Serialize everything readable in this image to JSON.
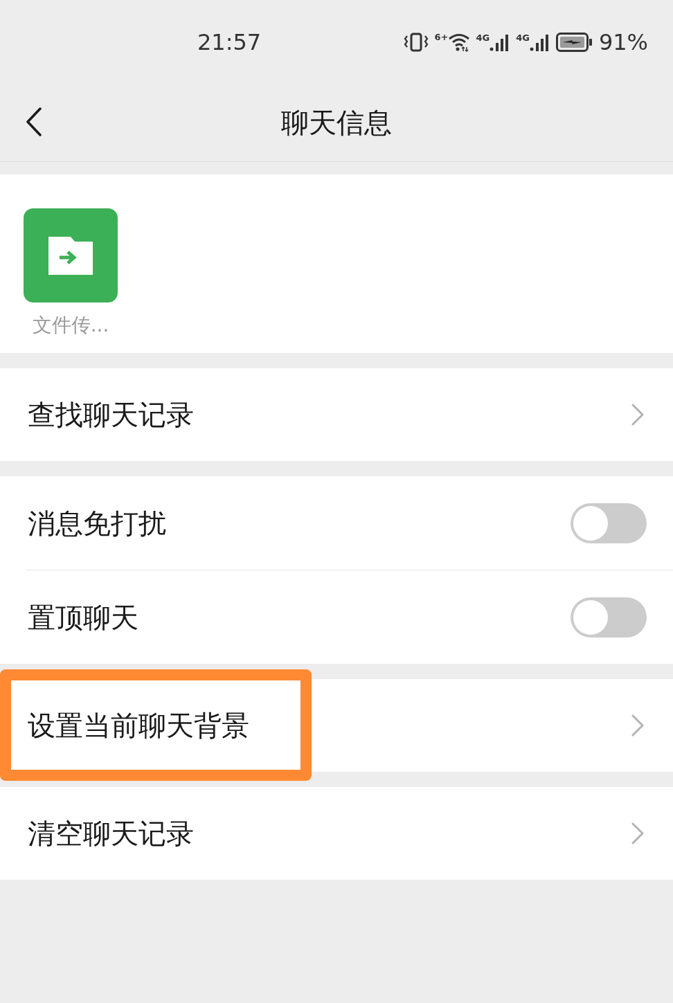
{
  "status_bar": {
    "time": "21:57",
    "wifi_label": "6+",
    "signals": [
      {
        "label": "4G"
      },
      {
        "label": "4G"
      }
    ],
    "battery": {
      "charging": true
    },
    "battery_text": "91%"
  },
  "nav": {
    "title": "聊天信息"
  },
  "members": [
    {
      "name": "文件传..."
    }
  ],
  "sections": [
    {
      "items": [
        {
          "kind": "link",
          "label": "查找聊天记录",
          "highlighted": false
        }
      ]
    },
    {
      "items": [
        {
          "kind": "toggle",
          "label": "消息免打扰",
          "on": false
        },
        {
          "kind": "toggle",
          "label": "置顶聊天",
          "on": false
        }
      ]
    },
    {
      "items": [
        {
          "kind": "link",
          "label": "设置当前聊天背景",
          "highlighted": true
        }
      ]
    },
    {
      "items": [
        {
          "kind": "link",
          "label": "清空聊天记录",
          "highlighted": false
        }
      ]
    }
  ]
}
